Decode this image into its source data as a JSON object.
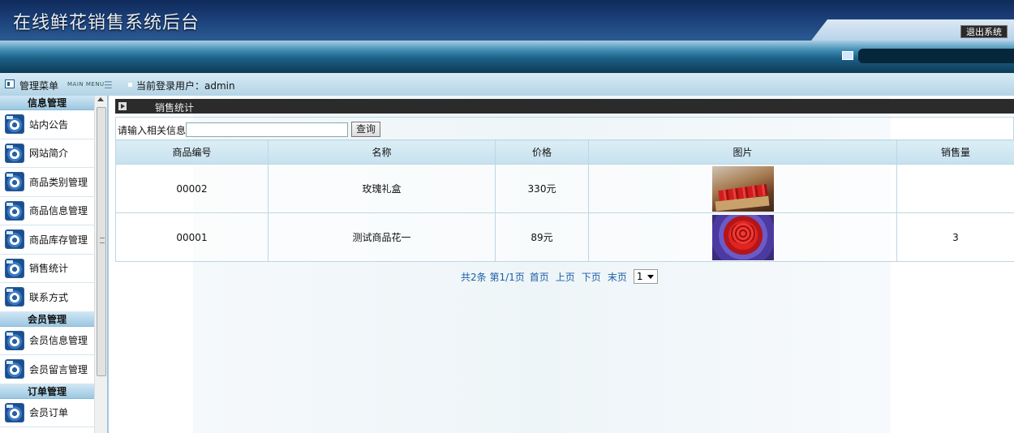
{
  "header": {
    "title": "在线鲜花销售系统后台",
    "logout_label": "退出系统"
  },
  "infobar": {
    "menu_label": "管理菜单",
    "menu_label_en": "MAIN MENU",
    "menu_lines": "☰",
    "user_label": "当前登录用户：admin"
  },
  "sidebar": {
    "sections": [
      {
        "title": "信息管理",
        "items": [
          {
            "label": "站内公告"
          },
          {
            "label": "网站简介"
          },
          {
            "label": "商品类别管理"
          },
          {
            "label": "商品信息管理"
          },
          {
            "label": "商品库存管理"
          },
          {
            "label": "销售统计"
          },
          {
            "label": "联系方式"
          }
        ]
      },
      {
        "title": "会员管理",
        "items": [
          {
            "label": "会员信息管理"
          },
          {
            "label": "会员留言管理"
          }
        ]
      },
      {
        "title": "订单管理",
        "items": [
          {
            "label": "会员订单"
          }
        ]
      }
    ]
  },
  "main": {
    "panel_title": "销售统计",
    "search": {
      "label": "请输入相关信息:",
      "value": "",
      "button_label": "查询"
    },
    "table": {
      "headers": [
        "商品编号",
        "名称",
        "价格",
        "图片",
        "销售量"
      ],
      "rows": [
        {
          "id": "00002",
          "name": "玫瑰礼盒",
          "price": "330元",
          "sales": ""
        },
        {
          "id": "00001",
          "name": "测试商品花一",
          "price": "89元",
          "sales": "3"
        }
      ]
    },
    "pager": {
      "summary": "共2条 第1/1页",
      "first": "首页",
      "prev": "上页",
      "next": "下页",
      "last": "末页",
      "current_page": "1"
    }
  },
  "colors": {
    "header_dark": "#0f2a5a",
    "nav_blue": "#1c5f86",
    "table_border": "#bcd7e5",
    "link_blue": "#1d5ea8"
  }
}
